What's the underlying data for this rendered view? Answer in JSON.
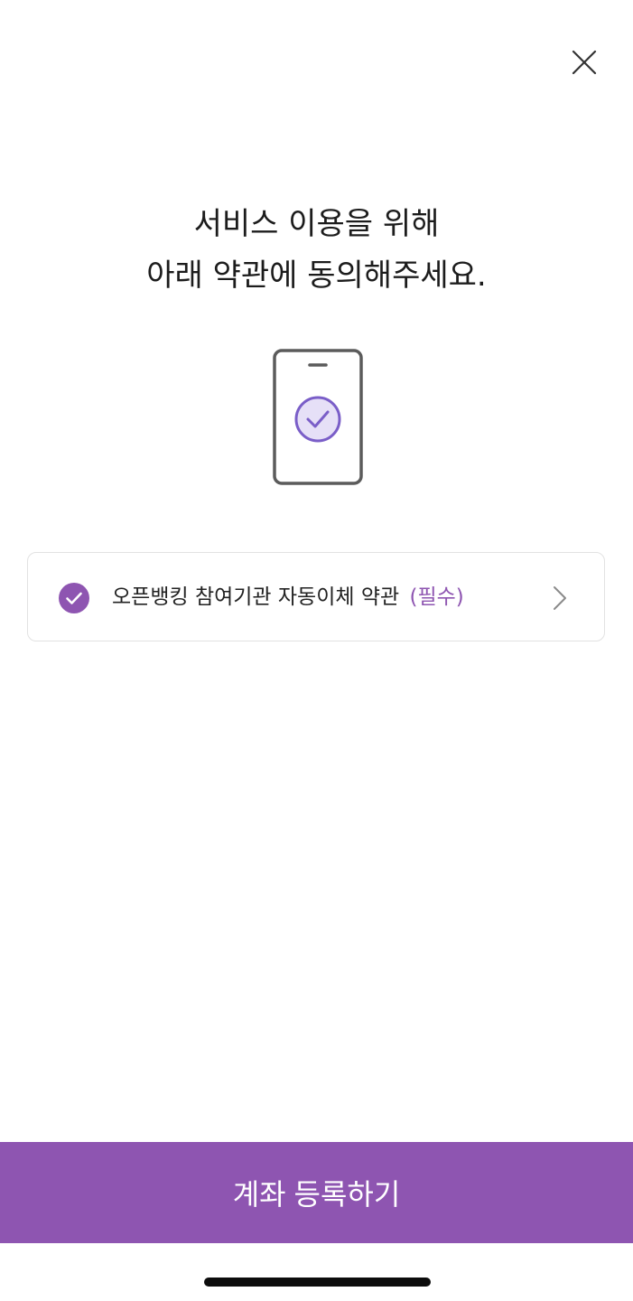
{
  "header": {
    "close_icon": "close-icon"
  },
  "headline": {
    "line1": "서비스 이용을 위해",
    "line2": "아래 약관에 동의해주세요."
  },
  "illustration": {
    "icon": "phone-check-icon"
  },
  "agreement": {
    "checked": true,
    "label": "오픈뱅킹 참여기관 자동이체 약관",
    "required_label": "(필수)",
    "check_icon": "checkmark-circle-icon",
    "chevron_icon": "chevron-right-icon"
  },
  "footer": {
    "primary_button_label": "계좌 등록하기"
  },
  "colors": {
    "accent": "#8e55b1",
    "accent_light": "#e6e0f7",
    "accent_stroke": "#7a5ec8",
    "text": "#1c1c1c",
    "border": "#e2e2e2"
  }
}
